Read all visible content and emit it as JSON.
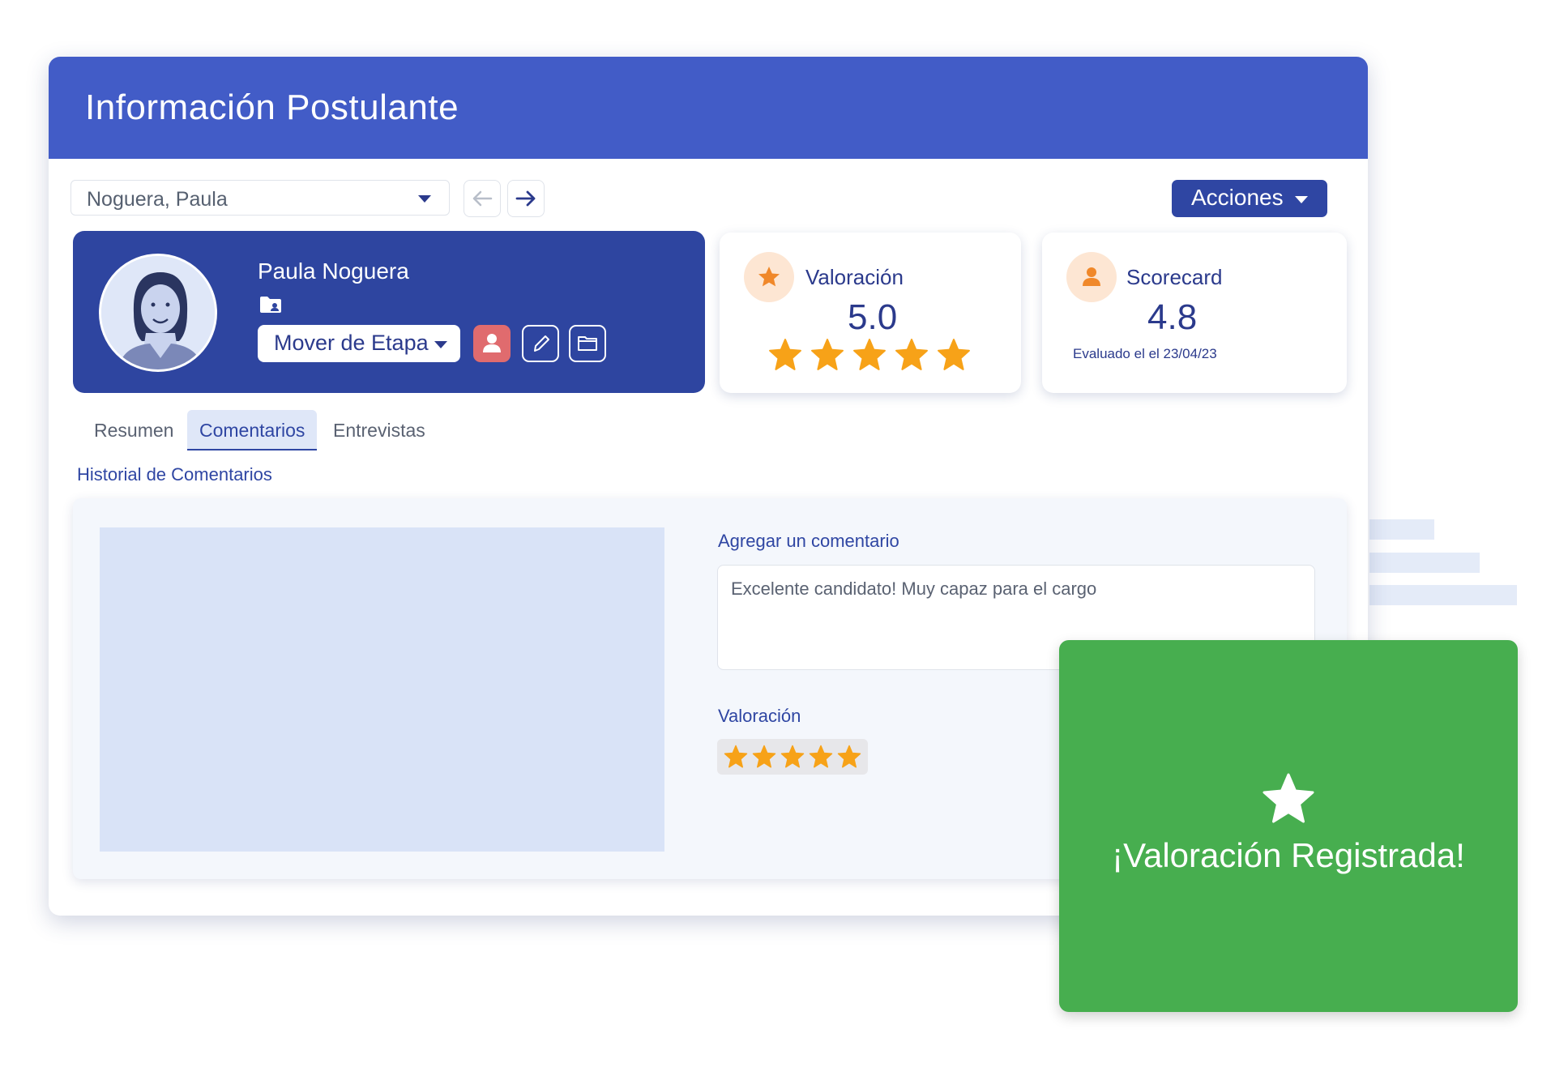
{
  "window": {
    "title": "Información Postulante"
  },
  "toolbar": {
    "candidate_select_value": "Noguera, Paula",
    "prev_label": "←",
    "next_label": "→",
    "actions_label": "Acciones"
  },
  "profile": {
    "name": "Paula Noguera",
    "move_stage_label": "Mover de Etapa"
  },
  "rating_card": {
    "label": "Valoración",
    "value": "5.0",
    "stars": 5
  },
  "scorecard_card": {
    "label": "Scorecard",
    "value": "4.8",
    "evaluated": "Evaluado el el 23/04/23"
  },
  "tabs": [
    {
      "label": "Resumen",
      "active": false
    },
    {
      "label": "Comentarios",
      "active": true
    },
    {
      "label": "Entrevistas",
      "active": false
    }
  ],
  "comments": {
    "history_title": "Historial de Comentarios",
    "add_label": "Agregar un comentario",
    "comment_value": "Excelente candidato! Muy capaz para el cargo",
    "rating_label": "Valoración",
    "rating_stars": 5
  },
  "toast": {
    "message": "¡Valoración Registrada!"
  },
  "colors": {
    "header": "#425cc7",
    "profile_card": "#2e45a0",
    "accent": "#2f46a3",
    "star": "#f7a218",
    "success": "#47ae4f",
    "danger_badge": "#e06b6e"
  },
  "icons": {
    "select_caret": "chevron-down-icon",
    "prev": "arrow-left-icon",
    "next": "arrow-right-icon",
    "folder": "folder-user-icon",
    "user": "user-icon",
    "edit": "pencil-icon",
    "open_folder": "folder-icon",
    "star": "star-icon"
  }
}
